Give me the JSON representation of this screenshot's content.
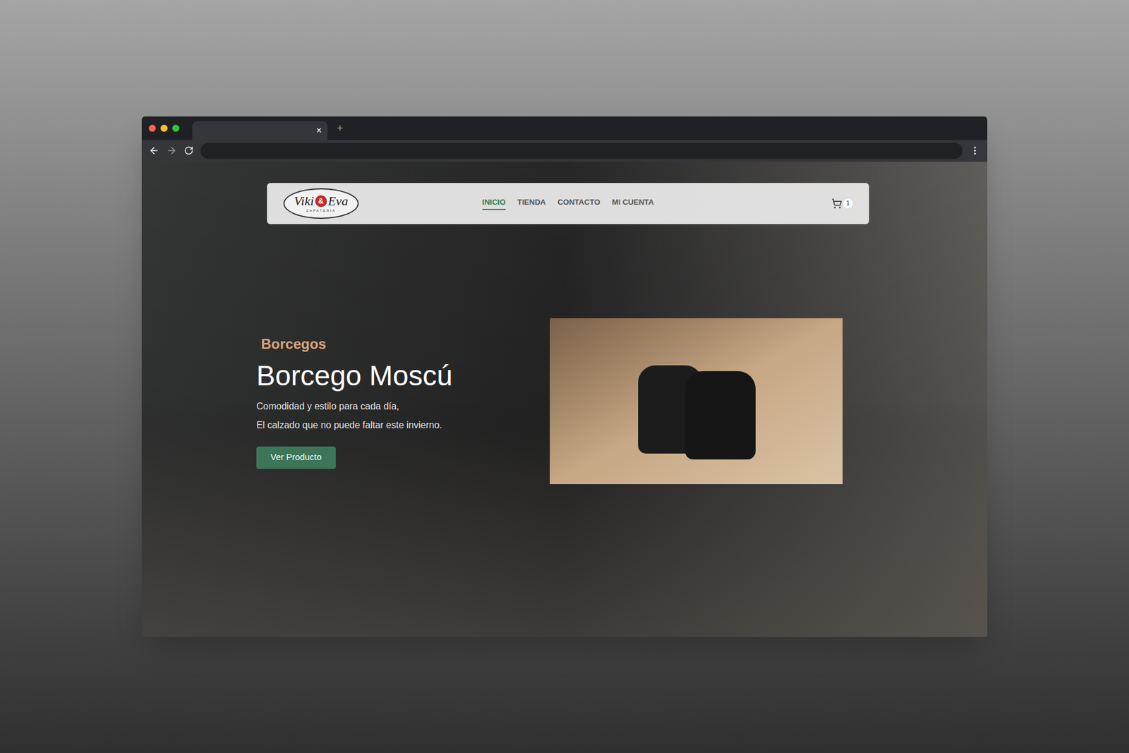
{
  "browser": {
    "tab_close": "×",
    "new_tab": "+"
  },
  "navbar": {
    "logo": {
      "name_left": "Viki",
      "ampersand": "&",
      "name_right": "Eva",
      "subtitle": "ZAPATERIA"
    },
    "links": [
      {
        "label": "INICIO",
        "selected": true
      },
      {
        "label": "TIENDA",
        "selected": false
      },
      {
        "label": "CONTACTO",
        "selected": false
      },
      {
        "label": "MI CUENTA",
        "selected": false
      }
    ],
    "cart": {
      "count": "1"
    }
  },
  "hero": {
    "category": "Borcegos",
    "title": "Borcego Moscú",
    "lines": [
      "Comodidad y estilo para cada día,",
      "El calzado que no puede faltar este invierno."
    ],
    "button": "Ver Producto"
  }
}
